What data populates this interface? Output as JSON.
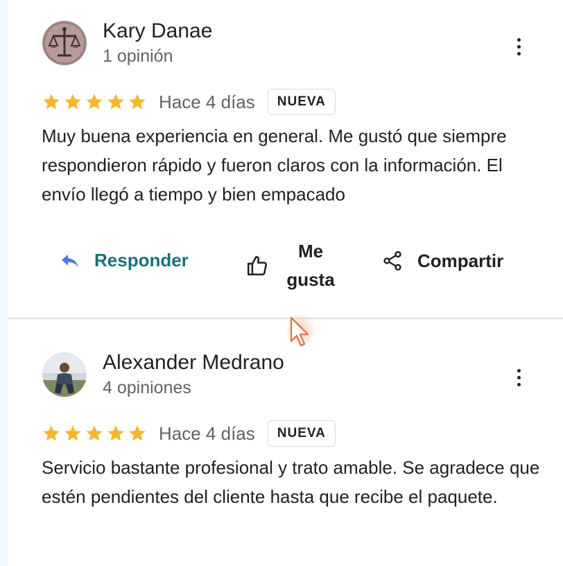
{
  "colors": {
    "star": "#f4b72f",
    "reply_accent": "#1f6f78",
    "reply_icon": "#4c7ce6",
    "muted": "#5f6368"
  },
  "actions": {
    "reply_label": "Responder",
    "like_label_line1": "Me",
    "like_label_line2": "gusta",
    "share_label": "Compartir"
  },
  "reviews": [
    {
      "name": "Kary Danae",
      "review_count": "1 opinión",
      "rating": 5,
      "date": "Hace 4 días",
      "badge": "NUEVA",
      "text": "Muy buena experiencia en general. Me gustó que siempre respondieron rápido y fueron claros con la información. El envío llegó a tiempo y bien empacado"
    },
    {
      "name": "Alexander Medrano",
      "review_count": "4 opiniones",
      "rating": 5,
      "date": "Hace 4 días",
      "badge": "NUEVA",
      "text": "Servicio bastante profesional y trato amable. Se agradece que estén pendientes del cliente hasta que recibe el paquete."
    }
  ]
}
